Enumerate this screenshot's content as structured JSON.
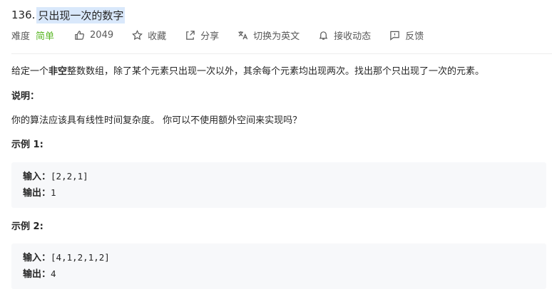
{
  "problem": {
    "number": "136.",
    "title": "只出现一次的数字"
  },
  "meta": {
    "difficulty_label": "难度",
    "difficulty_value": "简单",
    "likes": "2049",
    "favorite": "收藏",
    "share": "分享",
    "translate": "切换为英文",
    "notify": "接收动态",
    "feedback": "反馈"
  },
  "colors": {
    "difficulty_easy": "#5ab726",
    "title_highlight": "#d9e8fb",
    "code_bg": "#f7f8fa"
  },
  "description": {
    "intro_prefix": "给定一个",
    "intro_bold": "非空",
    "intro_suffix": "整数数组，除了某个元素只出现一次以外，其余每个元素均出现两次。找出那个只出现了一次的元素。",
    "note_heading": "说明：",
    "note_text": "你的算法应该具有线性时间复杂度。 你可以不使用额外空间来实现吗？"
  },
  "examples": [
    {
      "heading": "示例 1:",
      "input_label": "输入：",
      "input_value": "[2,2,1]",
      "output_label": "输出：",
      "output_value": "1"
    },
    {
      "heading": "示例 2:",
      "input_label": "输入：",
      "input_value": "[4,1,2,1,2]",
      "output_label": "输出：",
      "output_value": "4"
    }
  ]
}
